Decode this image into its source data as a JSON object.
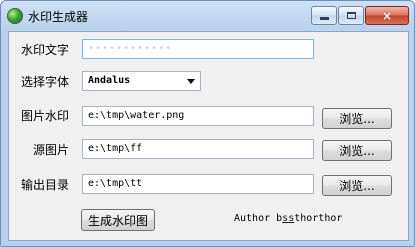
{
  "window": {
    "title": "水印生成器",
    "icon": "globe-icon"
  },
  "titlebar_buttons": {
    "minimize": "minimize-icon",
    "maximize": "maximize-icon",
    "close": "×"
  },
  "form": {
    "watermark_text": {
      "label": "水印文字",
      "value": "••••••••••••"
    },
    "font": {
      "label": "选择字体",
      "value": "Andalus"
    },
    "image_watermark": {
      "label": "图片水印",
      "value": "e:\\tmp\\water.png",
      "browse": "浏览..."
    },
    "source_image": {
      "label": "源图片",
      "value": "e:\\tmp\\ff",
      "browse": "浏览..."
    },
    "output_dir": {
      "label": "输出目录",
      "value": "e:\\tmp\\tt",
      "browse": "浏览..."
    }
  },
  "actions": {
    "generate": "生成水印图"
  },
  "footer": {
    "author_prefix": "Author b",
    "author_link": "ss",
    "author_suffix": "thorthor"
  },
  "colors": {
    "titlebar": "#b9d1ec",
    "client_bg": "#f0f0f0",
    "close_button": "#c2412c"
  }
}
